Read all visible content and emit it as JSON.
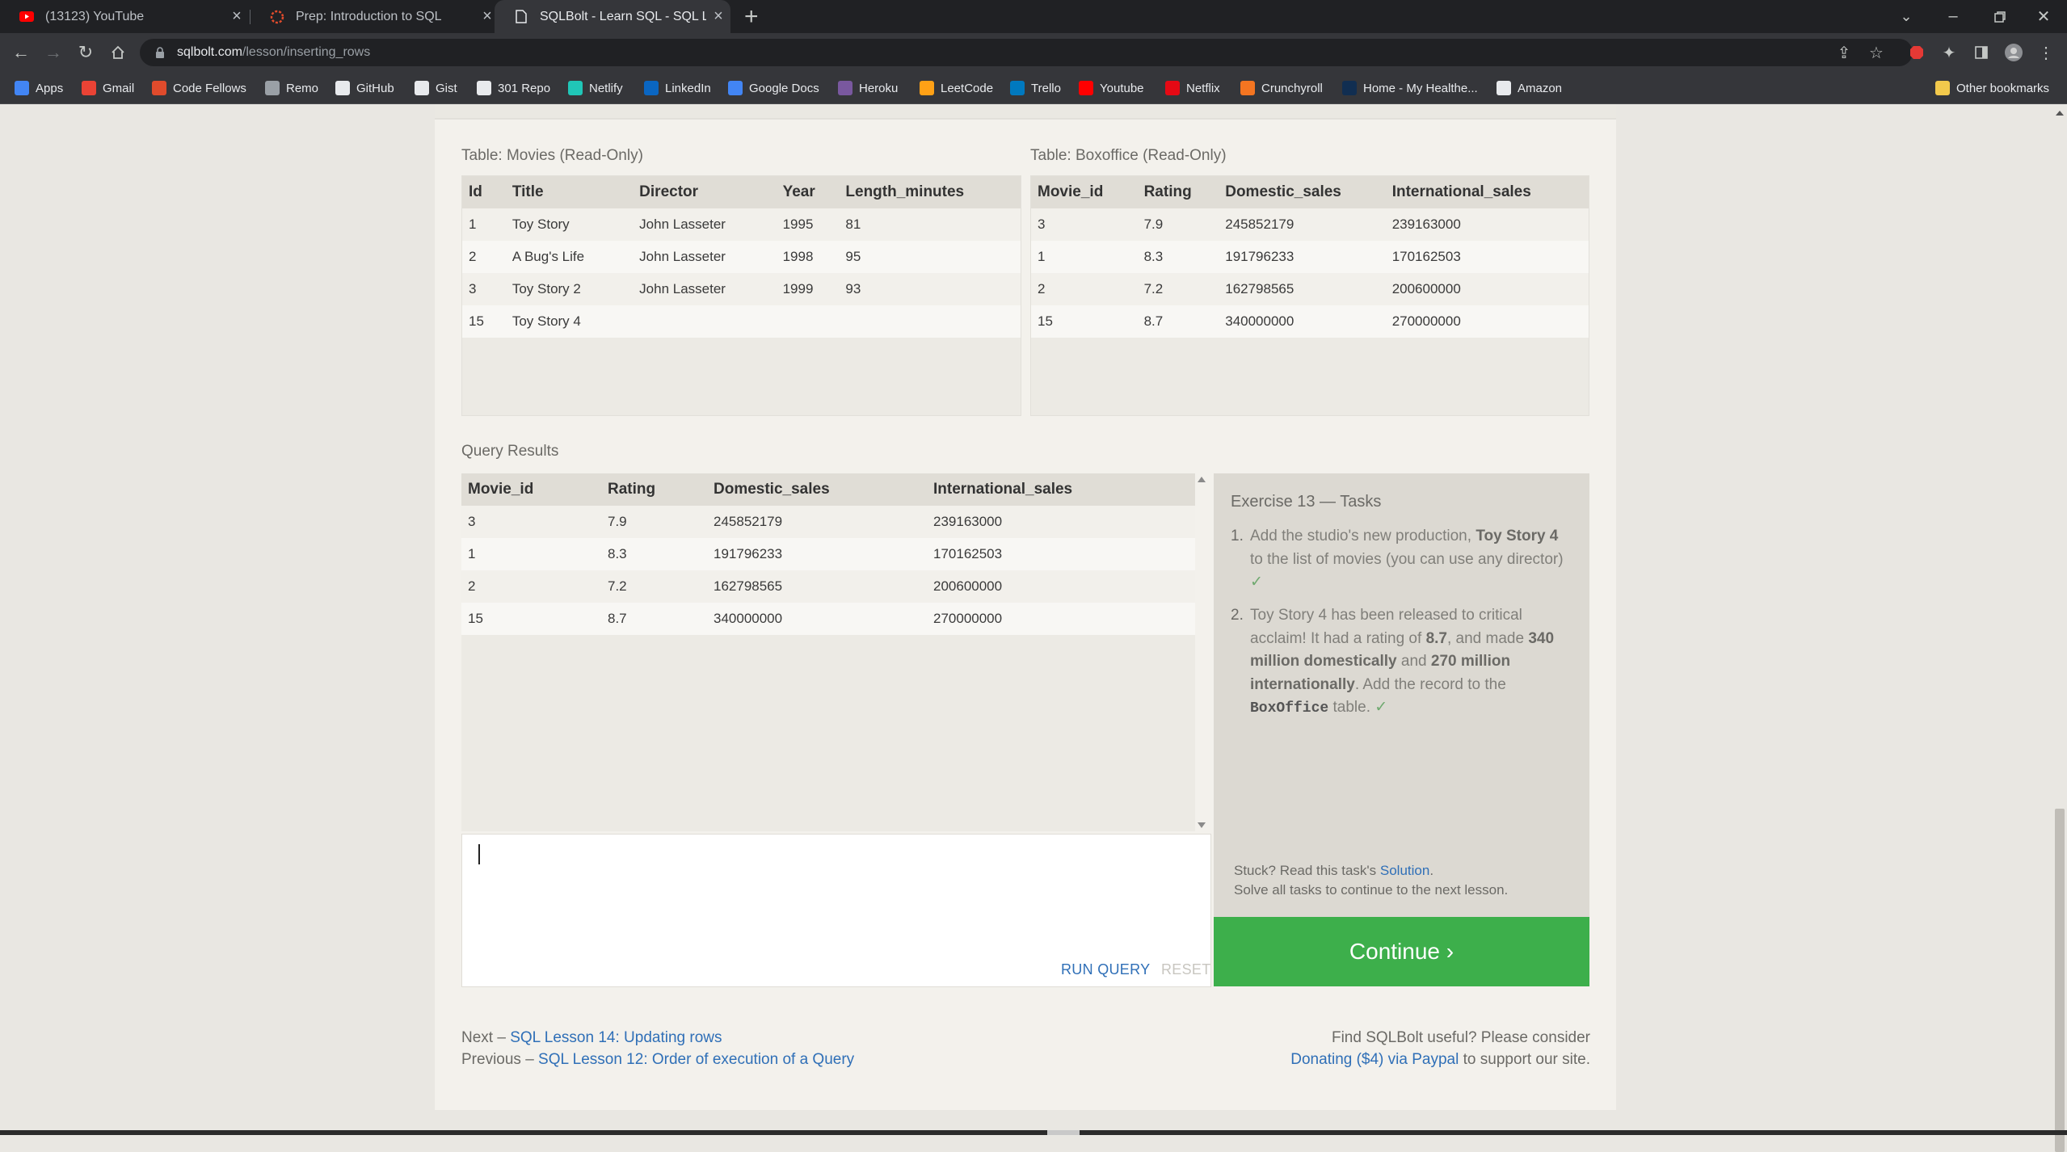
{
  "browser": {
    "tabs": [
      {
        "title": "(13123) YouTube",
        "icon": "youtube-icon"
      },
      {
        "title": "Prep: Introduction to SQL",
        "icon": "codefellows-icon"
      },
      {
        "title": "SQLBolt - Learn SQL - SQL Lesson",
        "icon": "page-icon"
      }
    ],
    "url_domain": "sqlbolt.com",
    "url_path": "/lesson/inserting_rows",
    "bookmarks": [
      {
        "label": "Apps",
        "icon": "apps-grid-icon",
        "color": "#4285f4"
      },
      {
        "label": "Gmail",
        "icon": "gmail-icon",
        "color": "#ea4335"
      },
      {
        "label": "Code Fellows",
        "icon": "codefellows-icon",
        "color": "#e04b2c"
      },
      {
        "label": "Remo",
        "icon": "remo-icon",
        "color": "#9aa0a6"
      },
      {
        "label": "GitHub",
        "icon": "github-icon",
        "color": "#e8eaed"
      },
      {
        "label": "Gist",
        "icon": "github-icon",
        "color": "#e8eaed"
      },
      {
        "label": "301 Repo",
        "icon": "github-icon",
        "color": "#e8eaed"
      },
      {
        "label": "Netlify",
        "icon": "netlify-icon",
        "color": "#20c6b7"
      },
      {
        "label": "LinkedIn",
        "icon": "linkedin-icon",
        "color": "#0a66c2"
      },
      {
        "label": "Google Docs",
        "icon": "google-docs-icon",
        "color": "#4285f4"
      },
      {
        "label": "Heroku",
        "icon": "heroku-icon",
        "color": "#79589f"
      },
      {
        "label": "LeetCode",
        "icon": "leetcode-icon",
        "color": "#ffa116"
      },
      {
        "label": "Trello",
        "icon": "trello-icon",
        "color": "#0079bf"
      },
      {
        "label": "Youtube",
        "icon": "youtube-icon",
        "color": "#ff0000"
      },
      {
        "label": "Netflix",
        "icon": "netflix-icon",
        "color": "#e50914"
      },
      {
        "label": "Crunchyroll",
        "icon": "crunchyroll-icon",
        "color": "#f47521"
      },
      {
        "label": "Home - My Healthe...",
        "icon": "va-icon",
        "color": "#112e51"
      },
      {
        "label": "Amazon",
        "icon": "amazon-icon",
        "color": "#e8eaed"
      }
    ],
    "other_bookmarks": "Other bookmarks"
  },
  "movies_table": {
    "caption": "Table: Movies (Read-Only)",
    "headers": [
      "Id",
      "Title",
      "Director",
      "Year",
      "Length_minutes"
    ],
    "rows": [
      [
        "1",
        "Toy Story",
        "John Lasseter",
        "1995",
        "81"
      ],
      [
        "2",
        "A Bug's Life",
        "John Lasseter",
        "1998",
        "95"
      ],
      [
        "3",
        "Toy Story 2",
        "John Lasseter",
        "1999",
        "93"
      ],
      [
        "15",
        "Toy Story 4",
        "",
        "",
        ""
      ]
    ]
  },
  "boxoffice_table": {
    "caption": "Table: Boxoffice (Read-Only)",
    "headers": [
      "Movie_id",
      "Rating",
      "Domestic_sales",
      "International_sales"
    ],
    "rows": [
      [
        "3",
        "7.9",
        "245852179",
        "239163000"
      ],
      [
        "1",
        "8.3",
        "191796233",
        "170162503"
      ],
      [
        "2",
        "7.2",
        "162798565",
        "200600000"
      ],
      [
        "15",
        "8.7",
        "340000000",
        "270000000"
      ]
    ]
  },
  "results": {
    "caption": "Query Results",
    "headers": [
      "Movie_id",
      "Rating",
      "Domestic_sales",
      "International_sales"
    ],
    "rows": [
      [
        "3",
        "7.9",
        "245852179",
        "239163000"
      ],
      [
        "1",
        "8.3",
        "191796233",
        "170162503"
      ],
      [
        "2",
        "7.2",
        "162798565",
        "200600000"
      ],
      [
        "15",
        "8.7",
        "340000000",
        "270000000"
      ]
    ]
  },
  "editor": {
    "run_label": "RUN QUERY",
    "reset_label": "RESET"
  },
  "exercise": {
    "title": "Exercise 13 — Tasks",
    "task1": {
      "num": "1.",
      "text": "Add the studio's new production, ",
      "bold": "Toy Story 4",
      "text2": " to the list of movies (you can use any director)",
      "check": "✓"
    },
    "task2": {
      "num": "2.",
      "t1": "Toy Story 4 has been released to critical acclaim! It had a rating of ",
      "b1": "8.7",
      "t2": ", and made ",
      "b2": "340 million domestically",
      "t3": " and ",
      "b3": "270 million internationally",
      "t4": ". Add the record to the ",
      "code": "BoxOffice",
      "t5": " table. ",
      "check": "✓"
    },
    "stuck_text": "Stuck? Read this task's ",
    "solution_link": "Solution",
    "stuck_period": ".",
    "solve_all": "Solve all tasks to continue to the next lesson.",
    "continue_label": "Continue ›"
  },
  "footer": {
    "next_prefix": "Next – ",
    "next_link": "SQL Lesson 14: Updating rows",
    "prev_prefix": "Previous – ",
    "prev_link": "SQL Lesson 12: Order of execution of a Query",
    "useful": "Find SQLBolt useful? Please consider",
    "donate_link": "Donating ($4) via Paypal",
    "donate_suffix": " to support our site."
  }
}
